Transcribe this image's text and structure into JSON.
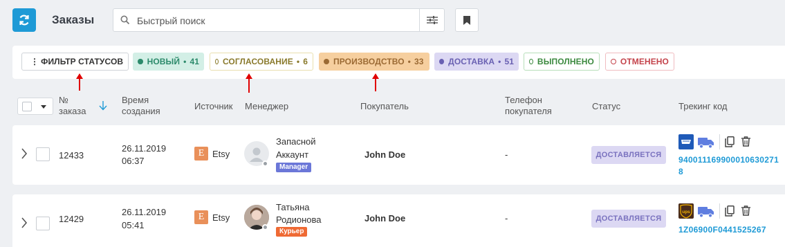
{
  "header": {
    "title": "Заказы",
    "search_placeholder": "Быстрый поиск"
  },
  "status_filters": {
    "filter_label": "ФИЛЬТР СТАТУСОВ",
    "chips": [
      {
        "label": "НОВЫЙ",
        "count": "41",
        "color": "#2c8a6b"
      },
      {
        "label": "СОГЛАСОВАНИЕ",
        "count": "6",
        "color": "#8a7a2c"
      },
      {
        "label": "ПРОИЗВОДСТВО",
        "count": "33",
        "color": "#9b6a34"
      },
      {
        "label": "ДОСТАВКА",
        "count": "51",
        "color": "#6960b2"
      },
      {
        "label": "ВЫПОЛНЕНО",
        "count": "",
        "color": "#3c8a3f"
      },
      {
        "label": "ОТМЕНЕНО",
        "count": "",
        "color": "#c4434b"
      }
    ]
  },
  "table": {
    "columns": {
      "order_no": "№\nзаказа",
      "created": "Время\nсоздания",
      "source": "Источник",
      "manager": "Менеджер",
      "buyer": "Покупатель",
      "phone": "Телефон\nпокупателя",
      "status": "Статус",
      "tracking": "Трекинг код"
    },
    "rows": [
      {
        "order_no": "12433",
        "date": "26.11.2019",
        "time": "06:37",
        "source": "Etsy",
        "manager_line1": "Запасной",
        "manager_line2": "Аккаунт",
        "role": "Manager",
        "buyer": "John Doe",
        "phone": "-",
        "status": "ДОСТАВЛЯЕТСЯ",
        "carrier": "usps-icon",
        "tracking": "9400111699000106302718"
      },
      {
        "order_no": "12429",
        "date": "26.11.2019",
        "time": "05:41",
        "source": "Etsy",
        "manager_line1": "Татьяна",
        "manager_line2": "Родионова",
        "role": "Курьер",
        "buyer": "John Doe",
        "phone": "-",
        "status": "ДОСТАВЛЯЕТСЯ",
        "carrier": "ups-icon",
        "tracking": "1Z06900F0441525267"
      }
    ]
  }
}
